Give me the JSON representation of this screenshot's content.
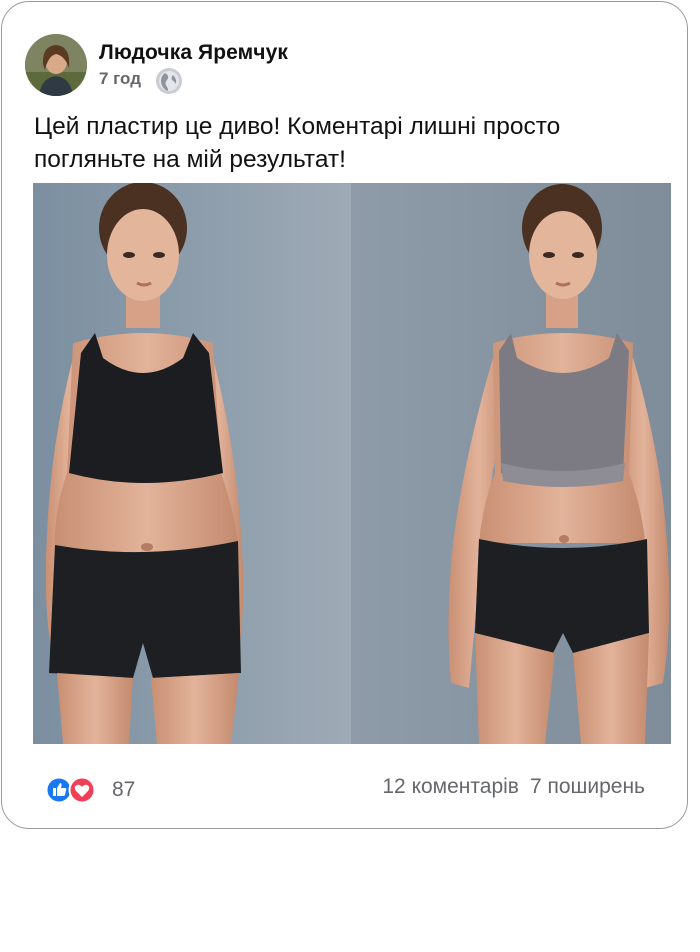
{
  "post": {
    "author": "Людочка Яремчук",
    "time": "7 год",
    "privacy_icon": "globe-icon",
    "text": "Цей пластир це диво! Коментарі лишні просто погляньте на мій результат!",
    "photo_description": "",
    "reactions": {
      "icons": [
        "like-icon",
        "love-icon"
      ],
      "count": "87"
    },
    "comments": "12 коментарів",
    "shares": "7 поширень"
  },
  "colors": {
    "like_blue": "#1877f2",
    "love_red": "#f33e58",
    "meta_gray": "#65676b"
  }
}
